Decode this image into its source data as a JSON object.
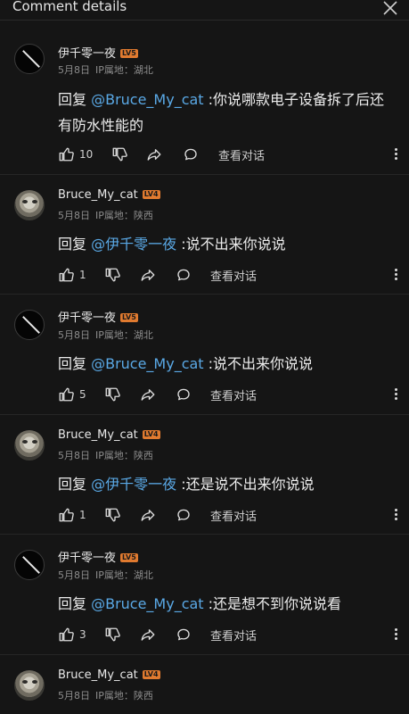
{
  "header": {
    "title": "Comment details"
  },
  "comments": [
    {
      "user": "伊千零一夜",
      "badge": "LV5",
      "date": "5月8日",
      "location": "IP属地：湖北",
      "reply_prefix": "回复 ",
      "mention": "@Bruce_My_cat",
      "text": " :你说哪款电子设备拆了后还有防水性能的",
      "likes": "10",
      "view_label": "查看对话"
    },
    {
      "user": "Bruce_My_cat",
      "badge": "LV4",
      "date": "5月8日",
      "location": "IP属地：陕西",
      "reply_prefix": "回复 ",
      "mention": "@伊千零一夜",
      "text": " :说不出来你说说",
      "likes": "1",
      "view_label": "查看对话"
    },
    {
      "user": "伊千零一夜",
      "badge": "LV5",
      "date": "5月8日",
      "location": "IP属地：湖北",
      "reply_prefix": "回复 ",
      "mention": "@Bruce_My_cat",
      "text": " :说不出来你说说",
      "likes": "5",
      "view_label": "查看对话"
    },
    {
      "user": "Bruce_My_cat",
      "badge": "LV4",
      "date": "5月8日",
      "location": "IP属地：陕西",
      "reply_prefix": "回复 ",
      "mention": "@伊千零一夜",
      "text": " :还是说不出来你说说",
      "likes": "1",
      "view_label": "查看对话"
    },
    {
      "user": "伊千零一夜",
      "badge": "LV5",
      "date": "5月8日",
      "location": "IP属地：湖北",
      "reply_prefix": "回复 ",
      "mention": "@Bruce_My_cat",
      "text": " :还是想不到你说说看",
      "likes": "3",
      "view_label": "查看对话"
    },
    {
      "user": "Bruce_My_cat",
      "badge": "LV4",
      "date": "5月8日",
      "location": "IP属地：陕西"
    }
  ],
  "colors": {
    "background": "#151515",
    "mention": "#5aa9e6",
    "badge": "#e07a2f",
    "meta": "#8c8c8c"
  }
}
